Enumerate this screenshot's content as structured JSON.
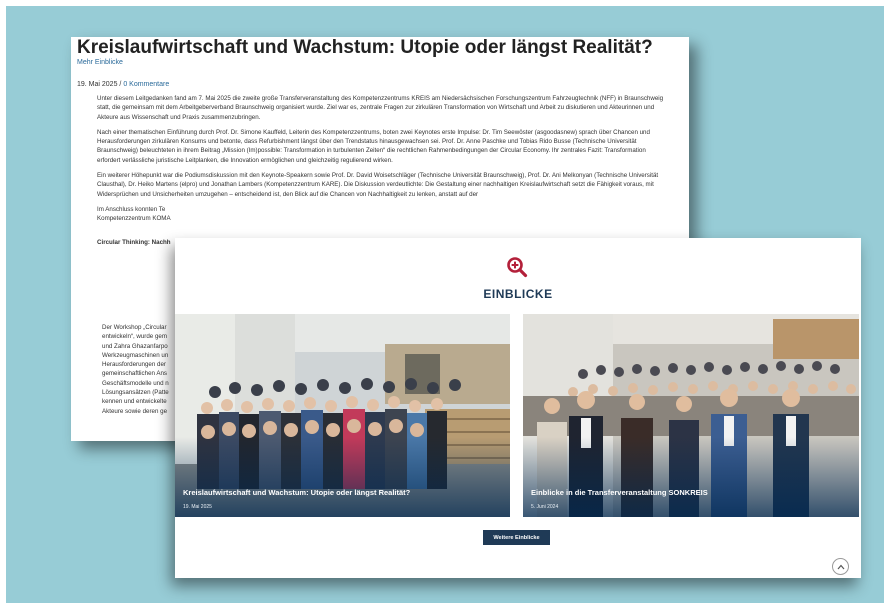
{
  "article": {
    "title": "Kreislaufwirtschaft und Wachstum: Utopie oder längst Realität?",
    "more_link": "Mehr Einblicke",
    "date": "19. Mai 2025",
    "separator": " / ",
    "comments": "0 Kommentare",
    "paragraphs": [
      "Unter diesem Leitgedanken fand am 7. Mai 2025 die zweite große Transferveranstaltung des Kompetenzzentrums KREIS am Niedersächsischen Forschungszentrum Fahrzeugtechnik (NFF) in Braunschweig statt, die gemeinsam mit dem Arbeitgeberverband Braunschweig organisiert wurde. Ziel war es, zentrale Fragen zur zirkulären Transformation von Wirtschaft und Arbeit zu diskutieren und Akteurinnen und Akteure aus Wissenschaft und Praxis zusammenzubringen.",
      "Nach einer thematischen Einführung durch Prof. Dr. Simone Kauffeld, Leiterin des Kompetenzzentrums, boten zwei Keynotes erste Impulse: Dr. Tim Seewöster (asgoodasnew) sprach über Chancen und Herausforderungen zirkulären Konsums und betonte, dass Refurbishment längst über den Trendstatus hinausgewachsen sei. Prof. Dr. Anne Paschke und Tobias Rido Busse (Technische Universität Braunschweig) beleuchteten in ihrem Beitrag „Mission (Im)possible: Transformation in turbulenten Zeiten“ die rechtlichen Rahmenbedingungen der Circular Economy. Ihr zentrales Fazit: Transformation erfordert verlässliche juristische Leitplanken, die Innovation ermöglichen und gleichzeitig regulierend wirken.",
      "Ein weiterer Höhepunkt war die Podiumsdiskussion mit den Keynote-Speakern sowie Prof. Dr. David Woisetschläger (Technische Universität Braunschweig), Prof. Dr. Ani Melkonyan (Technische Universität Clausthal), Dr. Heiko Martens (elpro) und Jonathan Lambers (Kompetenzzentrum KARE). Die Diskussion verdeutlichte: Die Gestaltung einer nachhaltigen Kreislaufwirtschaft setzt die Fähigkeit voraus, mit Widersprüchen und Unsicherheiten umzugehen – entscheidend ist, den Blick auf die Chancen von Nachhaltigkeit zu lenken, anstatt auf der",
      "Im Anschluss konnten Te",
      "Kompetenzzentrum KOMA"
    ],
    "subheading": "Circular Thinking: Nachh",
    "workshop_lines": [
      "Der Workshop „Circular",
      "entwickeln“, wurde gem",
      "und Zahra Ghazanfarpo",
      "Werkzeugmaschinen un",
      "Herausforderungen der",
      "gemeinschaftlichen Ans",
      "Geschäftsmodelle und n",
      "Lösungsansätzen (Patte",
      "kennen und entwickelte",
      "Akteure sowie deren ge"
    ]
  },
  "einblicke": {
    "heading": "EINBLICKE",
    "icon": "zoom-in-icon",
    "cards": [
      {
        "title": "Kreislaufwirtschaft und Wachstum: Utopie oder längst Realität?",
        "date": "19. Mai 2025"
      },
      {
        "title": "Einblicke in die Transferveranstaltung SONKREIS",
        "date": "5. Juni 2024"
      }
    ],
    "button": "Weitere Einblicke"
  },
  "colors": {
    "background": "#97ccd6",
    "heading": "#1f3a56",
    "accent": "#b3203a",
    "link": "#2a6a9a"
  }
}
